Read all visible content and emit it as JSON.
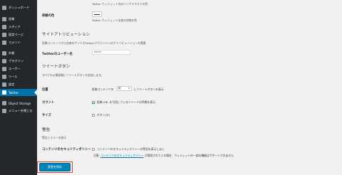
{
  "sidebar": {
    "items": [
      {
        "label": "ダッシュボード",
        "icon": "dashboard-icon"
      },
      {
        "label": "投稿",
        "icon": "pushpin-icon"
      },
      {
        "label": "メディア",
        "icon": "media-icon"
      },
      {
        "label": "固定ページ",
        "icon": "page-icon"
      },
      {
        "label": "コメント",
        "icon": "comment-icon"
      },
      {
        "label": "外観",
        "icon": "appearance-icon"
      },
      {
        "label": "プラグイン",
        "icon": "plugin-icon"
      },
      {
        "label": "ユーザー",
        "icon": "users-icon"
      },
      {
        "label": "ツール",
        "icon": "tools-icon"
      },
      {
        "label": "設定",
        "icon": "settings-icon"
      },
      {
        "label": "Twitter",
        "icon": "twitter-icon",
        "active": true
      },
      {
        "label": "Object Storage",
        "icon": "storage-icon"
      },
      {
        "label": "メニューを閉じる",
        "icon": "collapse-icon"
      }
    ]
  },
  "main": {
    "top_desc": "Twitter ウィジェット内のリンクテキストの色",
    "border_color": {
      "label": "枠線の色",
      "desc": "Twitter ウィジェット全体の枠線の色"
    },
    "attribution": {
      "title": "サイトアトリビューション",
      "desc": "投稿コンテンツから由来のサイトのTwitterアカウントへのアトリビューションを関連",
      "username_label": "Twitterのユーザー名",
      "username_value": "dsnet"
    },
    "tweet_button": {
      "title": "ツイートボタン",
      "desc": "すべての公開投稿にツイートボタンを追加します。",
      "position_label": "位置",
      "position_prefix": "投稿コンテンツの",
      "position_value": "前",
      "position_suffix": "にツイートボタンを表示",
      "count_label": "カウント",
      "count_text": "投稿 URL を引用しているツイートの件数を表示",
      "count_checked": true,
      "size_label": "サイズ",
      "size_text": "ボタン(大)",
      "size_checked": false
    },
    "warnings": {
      "title": "警告",
      "desc": "警告とエラーの表示",
      "csp_label": "コンテンツのセキュリティポリシー",
      "csp_text": "コンテンツのセキュリティポリシーの警告を表示しない",
      "csp_note_prefix": "注意:",
      "csp_note_link": "コンテンツのセキュリティポリシー",
      "csp_note_suffix": "が適用されている場合、ウィジェットの一部の機能はサポートされません"
    },
    "save_label": "変更を保存"
  }
}
